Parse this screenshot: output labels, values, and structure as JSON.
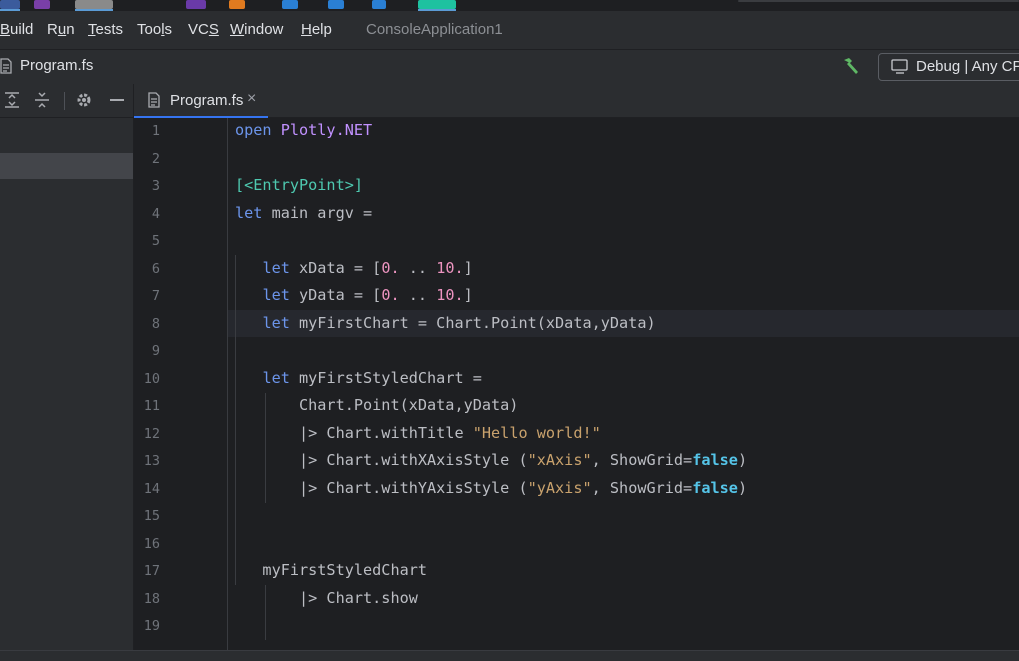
{
  "menu": {
    "items": [
      {
        "label": "Build",
        "mnemonic": "B"
      },
      {
        "label": "Run",
        "mnemonic": "u"
      },
      {
        "label": "Tests",
        "mnemonic": "T"
      },
      {
        "label": "Tools",
        "mnemonic": "l"
      },
      {
        "label": "VCS",
        "mnemonic": "S"
      },
      {
        "label": "Window",
        "mnemonic": "W"
      },
      {
        "label": "Help",
        "mnemonic": "H"
      }
    ],
    "project_title": "ConsoleApplication1"
  },
  "navbar": {
    "breadcrumb_file": "Program.fs",
    "run_config": "Debug | Any CPU",
    "build_icon": "hammer-icon"
  },
  "tabs": [
    {
      "label": "Program.fs",
      "close": "×",
      "active": true
    }
  ],
  "editor": {
    "current_line": 8,
    "lines": [
      {
        "n": "1",
        "tokens": [
          [
            "open ",
            "kw"
          ],
          [
            "Plotly.NET",
            "ns"
          ]
        ]
      },
      {
        "n": "2",
        "tokens": []
      },
      {
        "n": "3",
        "tokens": [
          [
            "[<EntryPoint>]",
            "attr"
          ]
        ]
      },
      {
        "n": "4",
        "tokens": [
          [
            "let ",
            "kw"
          ],
          [
            "main argv =",
            ""
          ]
        ]
      },
      {
        "n": "5",
        "tokens": []
      },
      {
        "n": "6",
        "tokens": [
          [
            "   ",
            ""
          ],
          [
            "let ",
            "kw"
          ],
          [
            "xData = [",
            ""
          ],
          [
            "0.",
            "num"
          ],
          [
            " .. ",
            ""
          ],
          [
            "10.",
            "num"
          ],
          [
            "]",
            ""
          ]
        ]
      },
      {
        "n": "7",
        "tokens": [
          [
            "   ",
            ""
          ],
          [
            "let ",
            "kw"
          ],
          [
            "yData = [",
            ""
          ],
          [
            "0.",
            "num"
          ],
          [
            " .. ",
            ""
          ],
          [
            "10.",
            "num"
          ],
          [
            "]",
            ""
          ]
        ]
      },
      {
        "n": "8",
        "tokens": [
          [
            "   ",
            ""
          ],
          [
            "let ",
            "kw"
          ],
          [
            "myFirstChart = Chart.Point(xData,yData)",
            ""
          ]
        ]
      },
      {
        "n": "9",
        "tokens": []
      },
      {
        "n": "10",
        "tokens": [
          [
            "   ",
            ""
          ],
          [
            "let ",
            "kw"
          ],
          [
            "myFirstStyledChart =",
            ""
          ]
        ]
      },
      {
        "n": "11",
        "tokens": [
          [
            "       Chart.Point(xData,yData)",
            ""
          ]
        ]
      },
      {
        "n": "12",
        "tokens": [
          [
            "       |> Chart.withTitle ",
            ""
          ],
          [
            "\"Hello world!\"",
            "str"
          ]
        ]
      },
      {
        "n": "13",
        "tokens": [
          [
            "       |> Chart.withXAxisStyle (",
            ""
          ],
          [
            "\"xAxis\"",
            "str"
          ],
          [
            ", ShowGrid=",
            ""
          ],
          [
            "false",
            "bool"
          ],
          [
            ")",
            ""
          ]
        ]
      },
      {
        "n": "14",
        "tokens": [
          [
            "       |> Chart.withYAxisStyle (",
            ""
          ],
          [
            "\"yAxis\"",
            "str"
          ],
          [
            ", ShowGrid=",
            ""
          ],
          [
            "false",
            "bool"
          ],
          [
            ")",
            ""
          ]
        ]
      },
      {
        "n": "15",
        "tokens": []
      },
      {
        "n": "16",
        "tokens": []
      },
      {
        "n": "17",
        "tokens": [
          [
            "   myFirstStyledChart",
            ""
          ]
        ]
      },
      {
        "n": "18",
        "tokens": [
          [
            "       |> Chart.show",
            ""
          ]
        ]
      },
      {
        "n": "19",
        "tokens": []
      }
    ]
  },
  "colors": {
    "keyword": "#6c95eb",
    "namespace": "#c191ff",
    "attribute": "#4ec9b0",
    "number": "#ed94c0",
    "string": "#c9a26d",
    "bool": "#55c4e8",
    "accent": "#3574f0"
  }
}
